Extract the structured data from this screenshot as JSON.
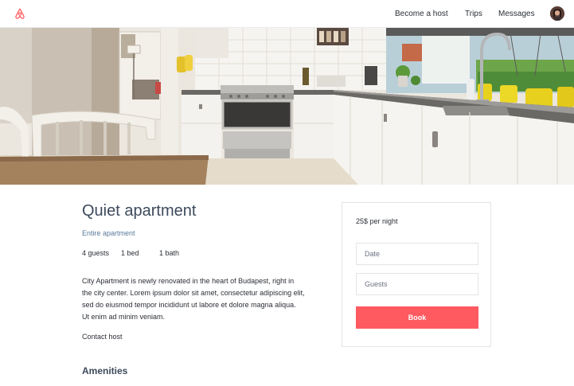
{
  "nav": {
    "logo_icon": "airbnb-logo-icon",
    "become_host": "Become a host",
    "trips": "Trips",
    "messages": "Messages",
    "accent": "#ff5a60"
  },
  "hero": {
    "description": ""
  },
  "listing": {
    "title": "Quiet apartment",
    "type": "Entire apartment",
    "guests": "4 guests",
    "beds": "1 bed",
    "baths": "1 bath",
    "description": "City Apartment is newly renovated in the heart of Budapest, right in the city center. Lorem ipsum dolor sit amet, consectetur adipiscing elit, sed do eiusmod tempor incididunt ut labore et dolore magna aliqua. Ut enim ad minim veniam.",
    "contact_host": "Contact host",
    "amenities_heading": "Amenities"
  },
  "booking": {
    "price": "25$ per night",
    "date_placeholder": "Date",
    "guests_placeholder": "Guests",
    "book_label": "Book",
    "book_color": "#ff5a60"
  }
}
